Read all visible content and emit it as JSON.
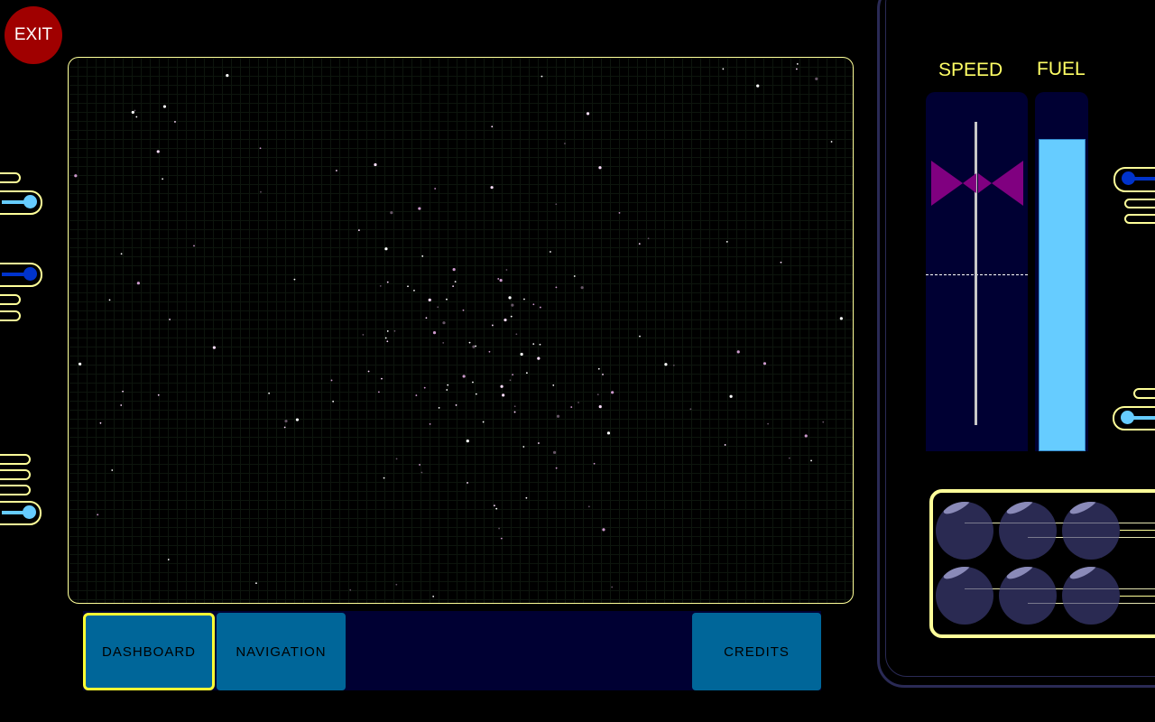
{
  "exit_label": "EXIT",
  "nav": {
    "tabs": [
      {
        "label": "DASHBOARD",
        "active": true
      },
      {
        "label": "NAVIGATION",
        "active": false
      },
      {
        "label": "CREDITS",
        "active": false
      }
    ]
  },
  "gauges": {
    "speed_label": "SPEED",
    "fuel_label": "FUEL",
    "fuel_level_percent": 87,
    "colors": {
      "fuel": "#66ccff",
      "speed_marker": "#800080",
      "accent": "#ffff66"
    }
  },
  "icons": [
    "exit-button",
    "slider-knob",
    "orb-button"
  ]
}
